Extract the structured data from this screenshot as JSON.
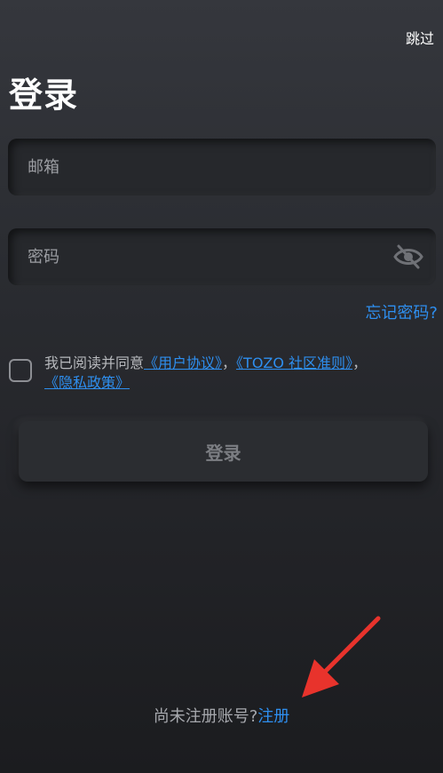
{
  "header": {
    "skip_label": "跳过",
    "title": "登录"
  },
  "form": {
    "email_placeholder": "邮箱",
    "password_placeholder": "密码",
    "forgot_label": "忘记密码?",
    "agreement": {
      "prefix": "我已阅读并同意",
      "user_agreement": "《用户协议》",
      "separator1": "，",
      "community_rules": "《TOZO 社区准则》",
      "separator2": "，",
      "privacy_policy": "《隐私政策》",
      "checked": false
    },
    "login_button": "登录"
  },
  "footer": {
    "no_account_text": "尚未注册账号?",
    "register_link": "注册"
  },
  "colors": {
    "link": "#2e8ff0",
    "annotation_arrow": "#e8332c"
  },
  "icons": {
    "password_visibility": "eye-off-icon"
  }
}
